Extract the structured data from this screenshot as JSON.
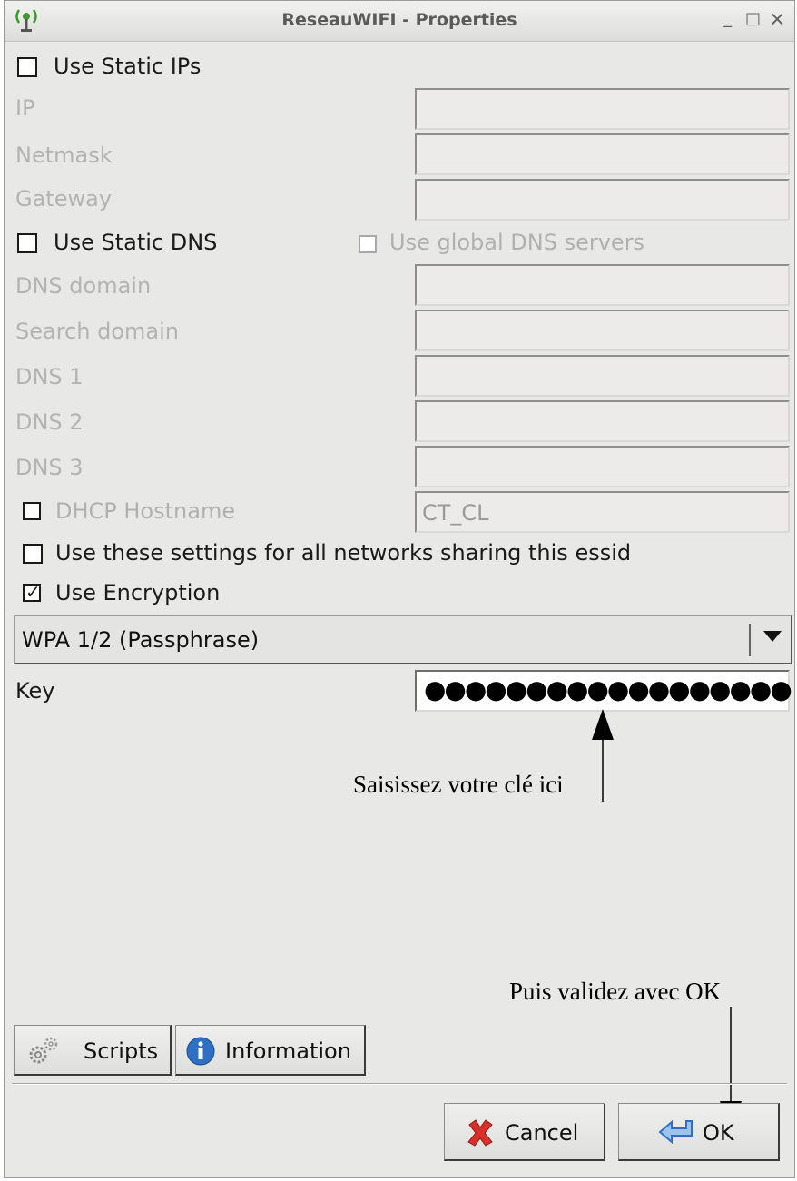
{
  "window": {
    "title": "ReseauWIFI - Properties",
    "minimize": "_",
    "maximize": "□",
    "close": "×"
  },
  "static_ip": {
    "label": "Use Static IPs",
    "checked": false
  },
  "ip_fields": [
    {
      "label": "IP",
      "value": ""
    },
    {
      "label": "Netmask",
      "value": ""
    },
    {
      "label": "Gateway",
      "value": ""
    }
  ],
  "static_dns": {
    "label": "Use Static DNS",
    "checked": false
  },
  "global_dns": {
    "label": "Use global DNS servers",
    "checked": false
  },
  "dns_fields": [
    {
      "label": "DNS domain",
      "value": ""
    },
    {
      "label": "Search domain",
      "value": ""
    },
    {
      "label": "DNS 1",
      "value": ""
    },
    {
      "label": "DNS 2",
      "value": ""
    },
    {
      "label": "DNS 3",
      "value": ""
    }
  ],
  "dhcp": {
    "label": "DHCP Hostname",
    "checked": false,
    "value": "CT_CL"
  },
  "share_essid": {
    "label": "Use these settings for all networks sharing this essid",
    "checked": false
  },
  "encryption": {
    "label": "Use Encryption",
    "checked": true,
    "check_glyph": "✓"
  },
  "encryption_type": {
    "selected": "WPA 1/2 (Passphrase)"
  },
  "key": {
    "label": "Key",
    "value": "●●●●●●●●●●●●●●●●●●"
  },
  "annotations": {
    "key_hint": "Saisissez votre clé ici",
    "ok_hint": "Puis validez avec OK"
  },
  "buttons": {
    "scripts": "Scripts",
    "information": "Information",
    "cancel": "Cancel",
    "ok": "OK"
  },
  "icons": {
    "app": "wifi-antenna-icon",
    "scripts": "gears-icon",
    "information": "info-icon",
    "cancel": "red-x-icon",
    "ok": "enter-arrow-icon"
  },
  "colors": {
    "accent_green": "#3a9a2a",
    "info_blue": "#2f6fc4",
    "cancel_red": "#d9302a",
    "ok_blue": "#4a8ad0"
  }
}
